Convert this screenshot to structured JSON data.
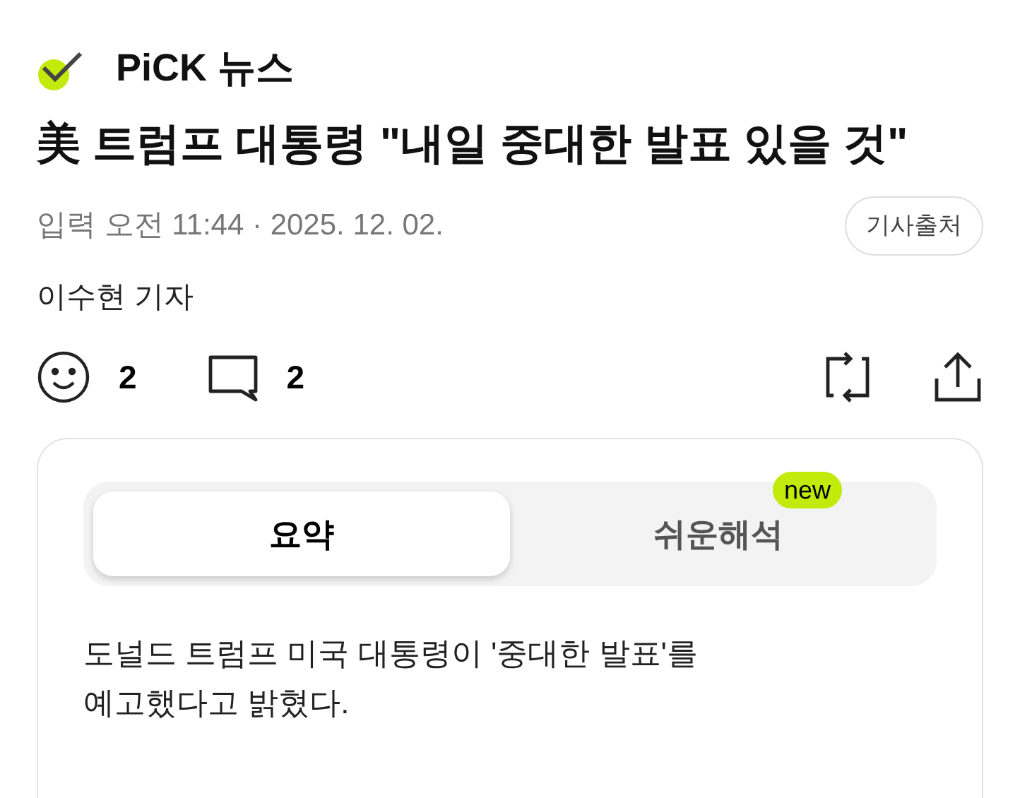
{
  "brand": {
    "name": "PiCK 뉴스"
  },
  "headline": "美 트럼프 대통령 \"내일 중대한 발표 있을 것\"",
  "meta": {
    "published": "입력 오전 11:44 · 2025. 12. 02.",
    "source_button": "기사출처"
  },
  "byline": "이수현 기자",
  "actions": {
    "reactions": "2",
    "comments": "2"
  },
  "summary_card": {
    "tabs": [
      {
        "label": "요약",
        "selected": true
      },
      {
        "label": "쉬운해석",
        "selected": false,
        "badge": "new"
      }
    ],
    "text": "도널드 트럼프 미국 대통령이 '중대한 발표'를\n예고했다고 밝혔다."
  }
}
